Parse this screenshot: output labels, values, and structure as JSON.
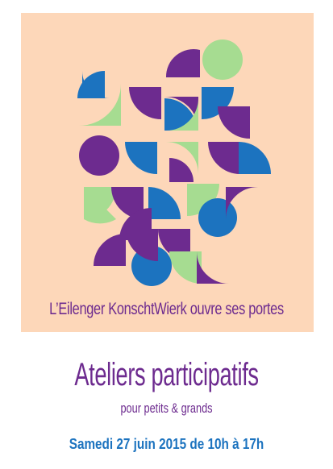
{
  "poster": {
    "tagline": "L’Eilenger KonschtWierk ouvre ses portes",
    "headline": "Ateliers participatifs",
    "subheadline": "pour petits & grands",
    "date_line": "Samedi 27 juin 2015 de 10h à 17h"
  },
  "colors": {
    "panel_background": "#fdd7b9",
    "purple": "#6d2b8f",
    "blue": "#1c73bf",
    "green": "#a6dc91"
  }
}
